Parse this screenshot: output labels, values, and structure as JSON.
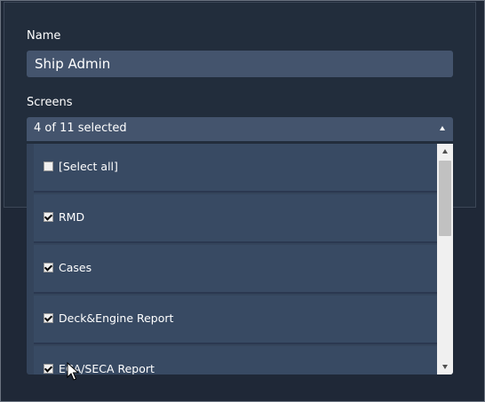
{
  "form": {
    "name_label": "Name",
    "name_value": "Ship Admin",
    "screens_label": "Screens",
    "screens_selected_text": "4 of 11 selected"
  },
  "dropdown": {
    "items": [
      {
        "label": "[Select all]",
        "checked": false
      },
      {
        "label": "RMD",
        "checked": true
      },
      {
        "label": "Cases",
        "checked": true
      },
      {
        "label": "Deck&Engine Report",
        "checked": true
      },
      {
        "label": "ECA/SECA Report",
        "checked": true
      }
    ]
  },
  "colors": {
    "background": "#1f2837",
    "input_bg": "#44546d",
    "item_bg": "#384a63"
  }
}
